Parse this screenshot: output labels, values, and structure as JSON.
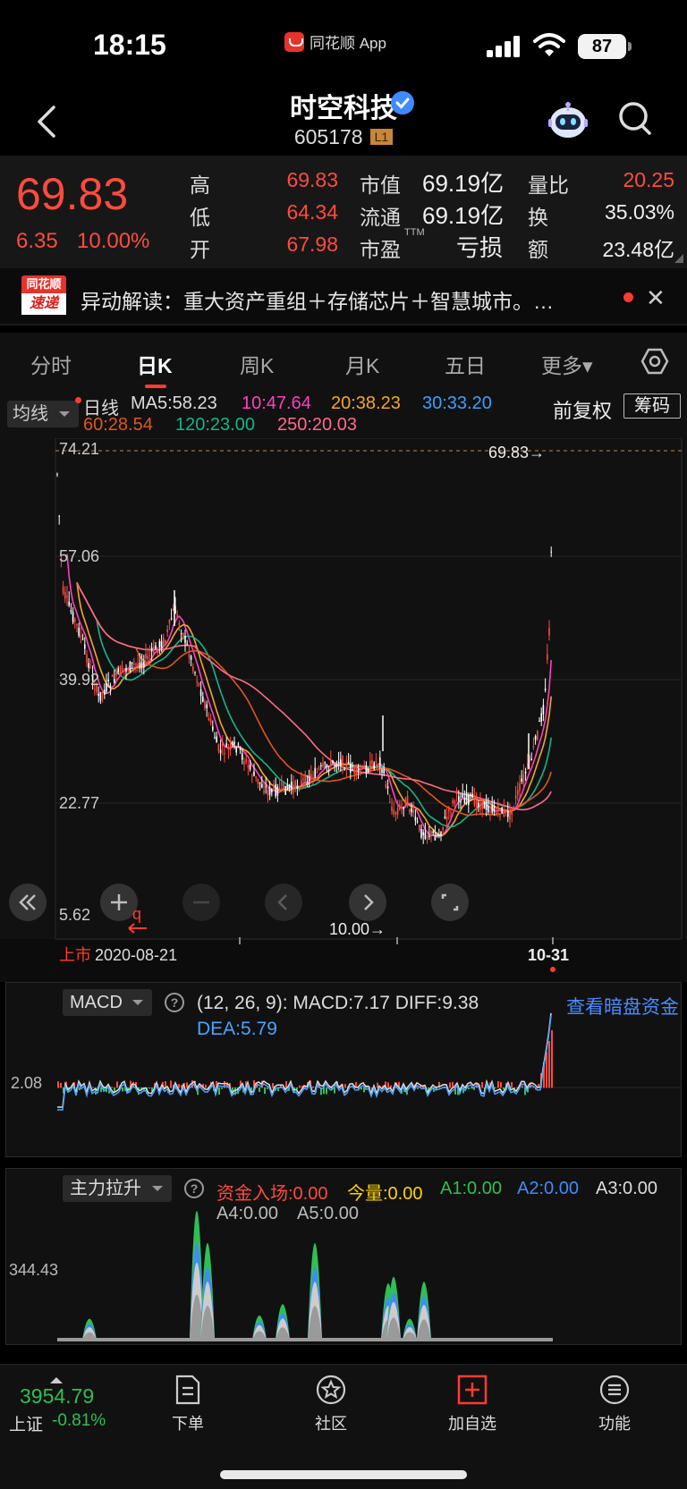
{
  "status": {
    "time": "18:15",
    "app_name": "同花顺 App",
    "battery": "87"
  },
  "header": {
    "name": "时空科技",
    "code": "605178",
    "level_badge": "L1"
  },
  "quote": {
    "price": "69.83",
    "change": "6.35",
    "change_pct": "10.00%",
    "high_label": "高",
    "high": "69.83",
    "low_label": "低",
    "low": "64.34",
    "open_label": "开",
    "open": "67.98",
    "mcap_label": "市值",
    "mcap": "69.19亿",
    "float_label": "流通",
    "float": "69.19亿",
    "pe_label": "市盈",
    "pe_sup": "TTM",
    "pe": "亏损",
    "vol_ratio_label": "量比",
    "vol_ratio": "20.25",
    "turnover_label": "换",
    "turnover": "35.03%",
    "amount_label": "额",
    "amount": "23.48亿"
  },
  "news": {
    "logo_top": "同花顺",
    "logo_bottom": "速递",
    "text": "异动解读：重大资产重组＋存储芯片＋智慧城市。…",
    "close": "✕"
  },
  "tabs": [
    {
      "label": "分时",
      "active": false
    },
    {
      "label": "日K",
      "active": true
    },
    {
      "label": "周K",
      "active": false
    },
    {
      "label": "月K",
      "active": false
    },
    {
      "label": "五日",
      "active": false
    },
    {
      "label": "更多▾",
      "active": false
    }
  ],
  "ma_bar": {
    "select": "均线",
    "period": "日线",
    "ma5": "MA5:58.23",
    "ma10": "10:47.64",
    "ma20": "20:38.23",
    "ma30": "30:33.20",
    "ma60": "60:28.54",
    "ma120": "120:23.00",
    "ma250": "250:20.03",
    "adjust": "前复权",
    "chips": "筹码"
  },
  "colors": {
    "ma5": "#ff3fbf",
    "ma10": "#ffffff",
    "ma20": "#f5a623",
    "ma30": "#3aa0ff",
    "ma60": "#e0561f",
    "ma120": "#18b486",
    "ma250": "#ff6b8a",
    "up": "#ff4b3e",
    "down": "#2fbf55"
  },
  "chart": {
    "y_ticks": [
      "74.21",
      "57.06",
      "39.92",
      "22.77",
      "5.62"
    ],
    "max_label": "69.83→",
    "min_label": "10.00→",
    "listing_tag": "上市",
    "start_date": "2020-08-21",
    "end_date": "10-31"
  },
  "macd": {
    "select": "MACD",
    "params": "(12, 26, 9):  MACD:7.17   DIFF:9.38",
    "dea": "DEA:5.79",
    "link": "查看暗盘资金",
    "y_tick": "2.08"
  },
  "force": {
    "select": "主力拉升",
    "items": [
      {
        "label": "资金入场:0.00",
        "color": "#ff4b3e"
      },
      {
        "label": "今量:0.00",
        "color": "#ffd400"
      },
      {
        "label": "A1:0.00",
        "color": "#2fbf55"
      },
      {
        "label": "A2:0.00",
        "color": "#3d8bff"
      },
      {
        "label": "A3:0.00",
        "color": "#dddddd"
      },
      {
        "label": "A4:0.00",
        "color": "#bbbbbb"
      },
      {
        "label": "A5:0.00",
        "color": "#bbbbbb"
      }
    ],
    "y_tick": "344.43"
  },
  "bottom": {
    "index_price": "3954.79",
    "index_name": "上证",
    "index_pct": "-0.81%",
    "nav": [
      {
        "label": "下单"
      },
      {
        "label": "社区"
      },
      {
        "label": "加自选"
      },
      {
        "label": "功能"
      }
    ]
  }
}
